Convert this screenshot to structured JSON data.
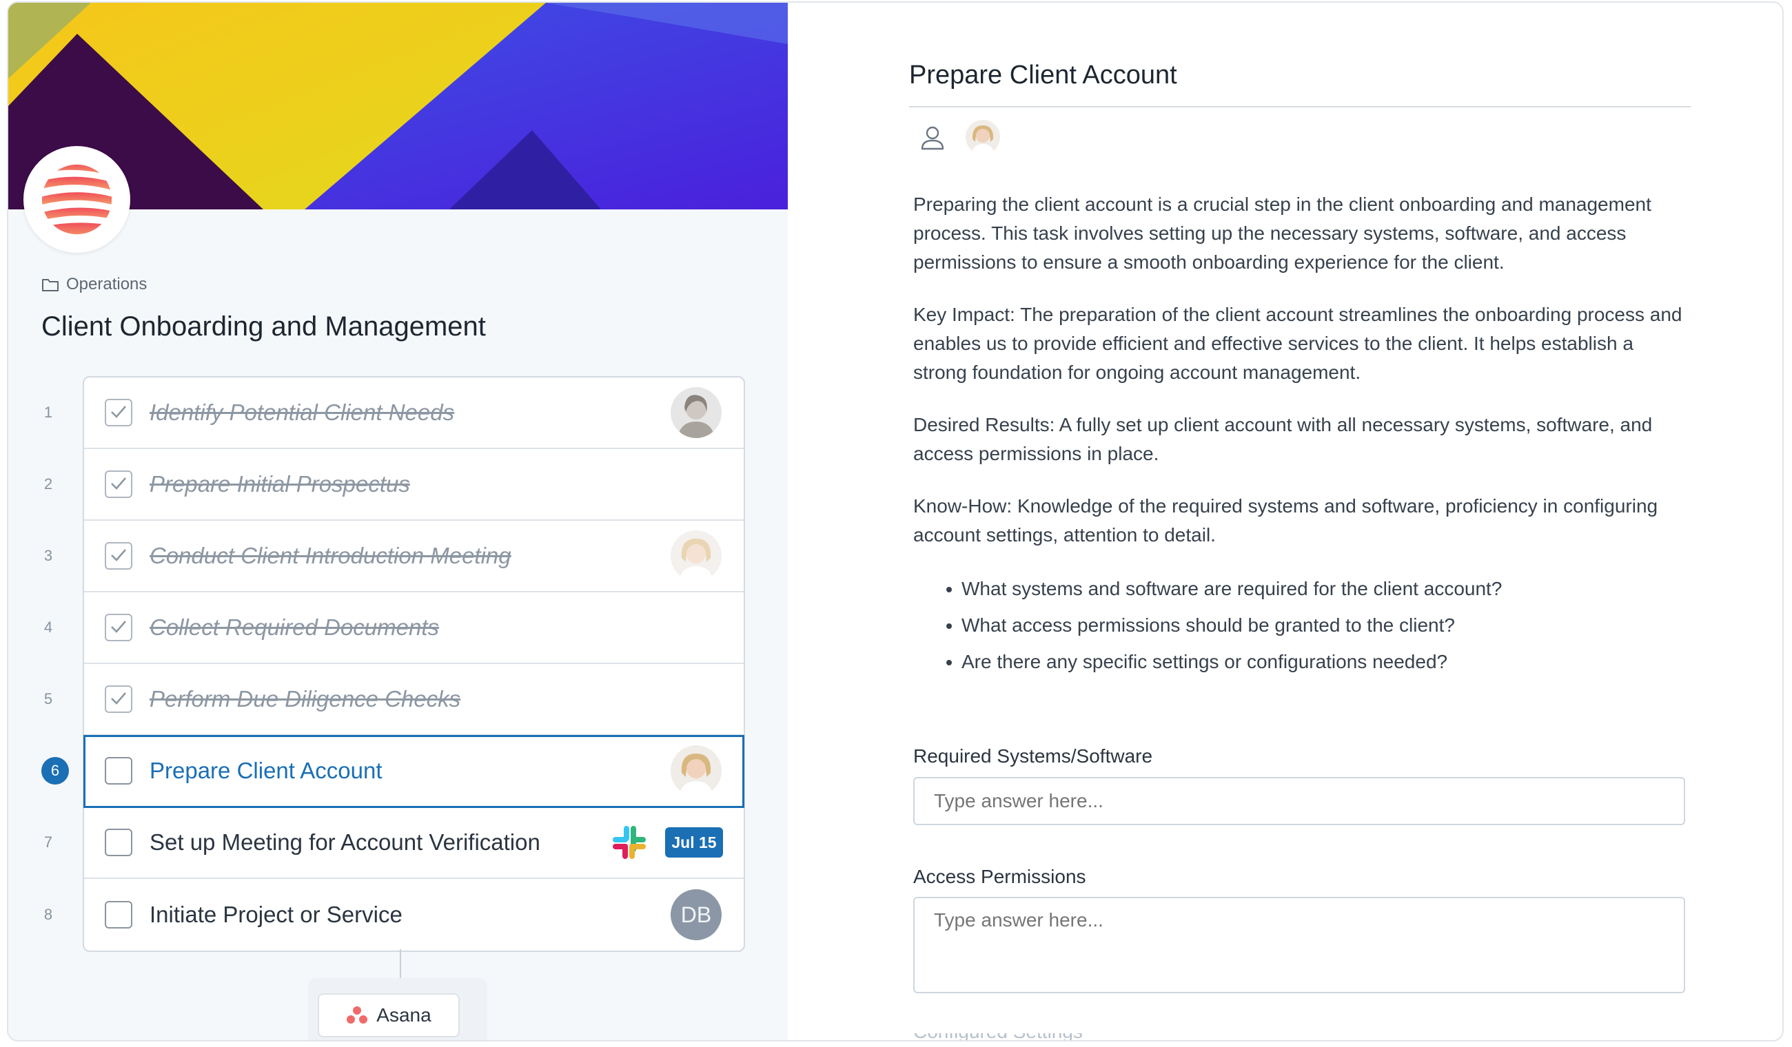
{
  "workflow": {
    "breadcrumb": "Operations",
    "title": "Client Onboarding and Management",
    "tasks": [
      {
        "number": "1",
        "label": "Identify Potential Client Needs",
        "status": "done",
        "avatar": "person-1"
      },
      {
        "number": "2",
        "label": "Prepare Initial Prospectus",
        "status": "done"
      },
      {
        "number": "3",
        "label": "Conduct Client Introduction Meeting",
        "status": "done",
        "avatar": "person-2"
      },
      {
        "number": "4",
        "label": "Collect Required Documents",
        "status": "done"
      },
      {
        "number": "5",
        "label": "Perform Due Diligence Checks",
        "status": "done"
      },
      {
        "number": "6",
        "label": "Prepare Client Account",
        "status": "active",
        "avatar": "person-2"
      },
      {
        "number": "7",
        "label": "Set up Meeting for Account Verification",
        "status": "open",
        "integration": "slack-icon",
        "due": "Jul 15"
      },
      {
        "number": "8",
        "label": "Initiate Project or Service",
        "status": "open",
        "avatar_initials": "DB"
      }
    ],
    "integration_button": "Asana"
  },
  "detail": {
    "title": "Prepare Client Account",
    "paragraphs": [
      "Preparing the client account is a crucial step in the client onboarding and management process. This task involves setting up the necessary systems, software, and access permissions to ensure a smooth onboarding experience for the client.",
      "Key Impact: The preparation of the client account streamlines the onboarding process and enables us to provide efficient and effective services to the client. It helps establish a strong foundation for ongoing account management.",
      "Desired Results: A fully set up client account with all necessary systems, software, and access permissions in place.",
      "Know-How: Knowledge of the required systems and software, proficiency in configuring account settings, attention to detail."
    ],
    "questions": [
      "What systems and software are required for the client account?",
      "What access permissions should be granted to the client?",
      "Are there any specific settings or configurations needed?"
    ],
    "fields": [
      {
        "label": "Required Systems/Software",
        "placeholder": "Type answer here...",
        "value": ""
      },
      {
        "label": "Access Permissions",
        "placeholder": "Type answer here...",
        "value": ""
      }
    ],
    "next_field_label": "Configured Settings"
  },
  "colors": {
    "accent": "#1a6fb5",
    "panel_bg": "#f5f8fb"
  }
}
